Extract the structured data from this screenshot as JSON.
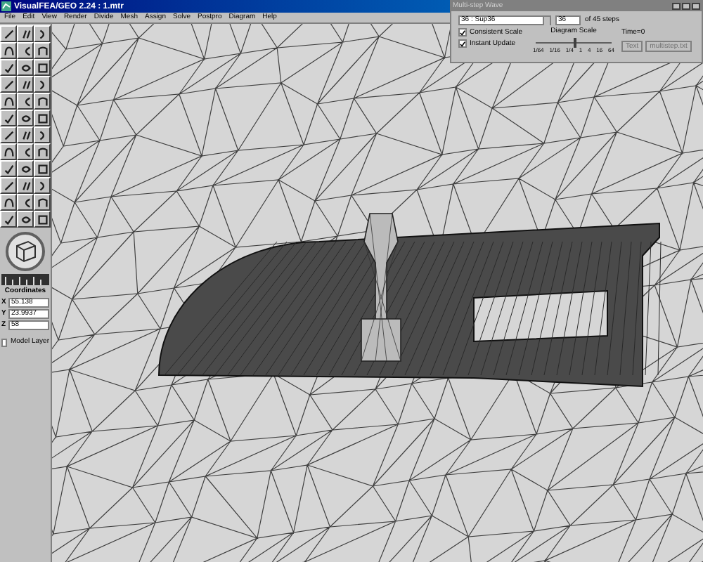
{
  "window": {
    "title": "VisualFEA/GEO 2.24 : 1.mtr"
  },
  "menu": [
    "File",
    "Edit",
    "View",
    "Render",
    "Divide",
    "Mesh",
    "Assign",
    "Solve",
    "Postpro",
    "Diagram",
    "Help"
  ],
  "coordinates": {
    "title": "Coordinates",
    "fields": [
      {
        "label": "X",
        "value": "55.138"
      },
      {
        "label": "Y",
        "value": "23.9937"
      },
      {
        "label": "Z",
        "value": "58"
      }
    ]
  },
  "model_layer": {
    "label": "Model Layer",
    "checked": false
  },
  "dialog": {
    "title": "Multi-step Wave",
    "step_select": "36 : Sup36",
    "step_spin": "36",
    "steps_label": "of 45 steps",
    "options": [
      {
        "label": "Consistent Scale",
        "checked": true
      },
      {
        "label": "Instant Update",
        "checked": true
      }
    ],
    "scale_title": "Diagram Scale",
    "scale_ticks": [
      "1/64",
      "1/16",
      "1/4",
      "1",
      "4",
      "16",
      "64"
    ],
    "level": 0.5,
    "time": "Time=0",
    "buttons": [
      {
        "label": "Text",
        "disabled": true
      },
      {
        "label": "multistep.txt",
        "disabled": true
      }
    ]
  }
}
